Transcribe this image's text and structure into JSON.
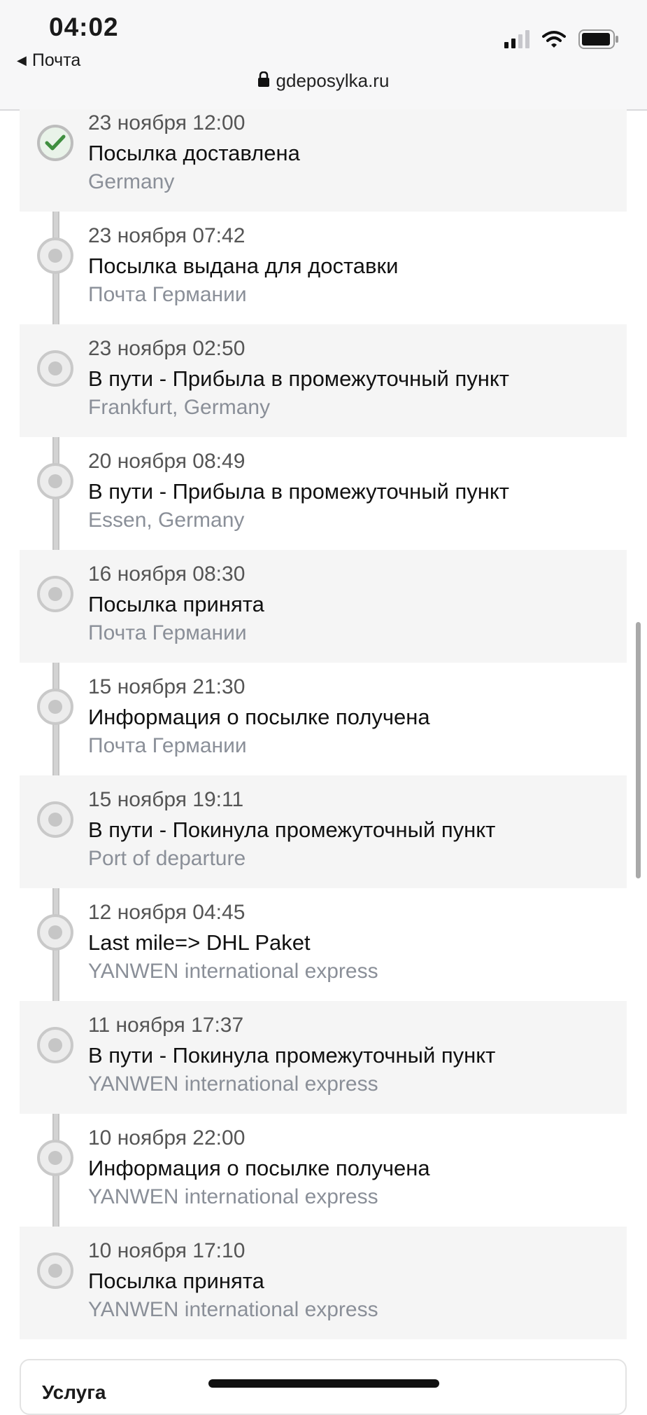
{
  "status_bar": {
    "time": "04:02",
    "back_label": "Почта"
  },
  "browser": {
    "url": "gdeposylka.ru"
  },
  "events": [
    {
      "date": "23 ноября 12:00",
      "title": "Посылка доставлена",
      "place": "Germany",
      "status": "delivered"
    },
    {
      "date": "23 ноября 07:42",
      "title": "Посылка выдана для доставки",
      "place": "Почта Германии",
      "status": "step"
    },
    {
      "date": "23 ноября 02:50",
      "title": "В пути - Прибыла в промежуточный пункт",
      "place": "Frankfurt, Germany",
      "status": "step"
    },
    {
      "date": "20 ноября 08:49",
      "title": "В пути - Прибыла в промежуточный пункт",
      "place": "Essen, Germany",
      "status": "step"
    },
    {
      "date": "16 ноября 08:30",
      "title": "Посылка принята",
      "place": "Почта Германии",
      "status": "step"
    },
    {
      "date": "15 ноября 21:30",
      "title": "Информация о посылке получена",
      "place": "Почта Германии",
      "status": "step"
    },
    {
      "date": "15 ноября 19:11",
      "title": "В пути - Покинула промежуточный пункт",
      "place": "Port of departure",
      "status": "step"
    },
    {
      "date": "12 ноября 04:45",
      "title": "Last mile=> DHL Paket",
      "place": "YANWEN international express",
      "status": "step"
    },
    {
      "date": "11 ноября 17:37",
      "title": "В пути - Покинула промежуточный пункт",
      "place": "YANWEN international express",
      "status": "step"
    },
    {
      "date": "10 ноября 22:00",
      "title": "Информация о посылке получена",
      "place": "YANWEN international express",
      "status": "step"
    },
    {
      "date": "10 ноября 17:10",
      "title": "Посылка принята",
      "place": "YANWEN international express",
      "status": "step"
    }
  ],
  "service_card": {
    "label": "Услуга"
  },
  "colors": {
    "delivered_check": "#3f8f3f",
    "rail": "#d3d3d3",
    "muted_text": "#8a8f98"
  }
}
